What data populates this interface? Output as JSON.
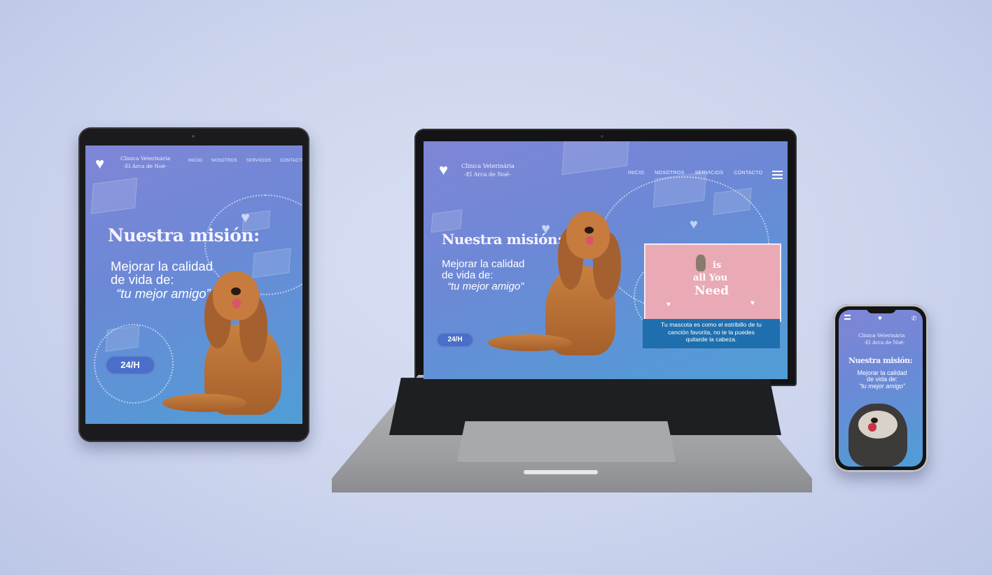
{
  "brand": {
    "line1": "Clinica Veterinária",
    "line2": "-El Arca de Noé-",
    "logo_icon": "heart-paw-icon"
  },
  "nav": {
    "items": [
      "INICIO",
      "NOSOTROS",
      "SERVICIOS",
      "CONTACTO"
    ]
  },
  "hero": {
    "title": "Nuestra misión:",
    "line1": "Mejorar la calidad",
    "line2": "de vida de:",
    "line3": "“tu mejor amigo”",
    "badge": "24/H"
  },
  "promo": {
    "word1": "is",
    "word2": "all You",
    "word3": "Need",
    "caption_line1": "Tu mascota es como el estribillo de tu",
    "caption_line2": "canción favorita,  no te la puedes",
    "caption_line3": "quitarde la cabeza."
  },
  "colors": {
    "screen_gradient_start": "#7f86d6",
    "screen_gradient_end": "#4f9ed6",
    "badge": "#4a6fc9",
    "promo_pink": "#e9aab6",
    "caption_blue": "#1f6fae"
  }
}
